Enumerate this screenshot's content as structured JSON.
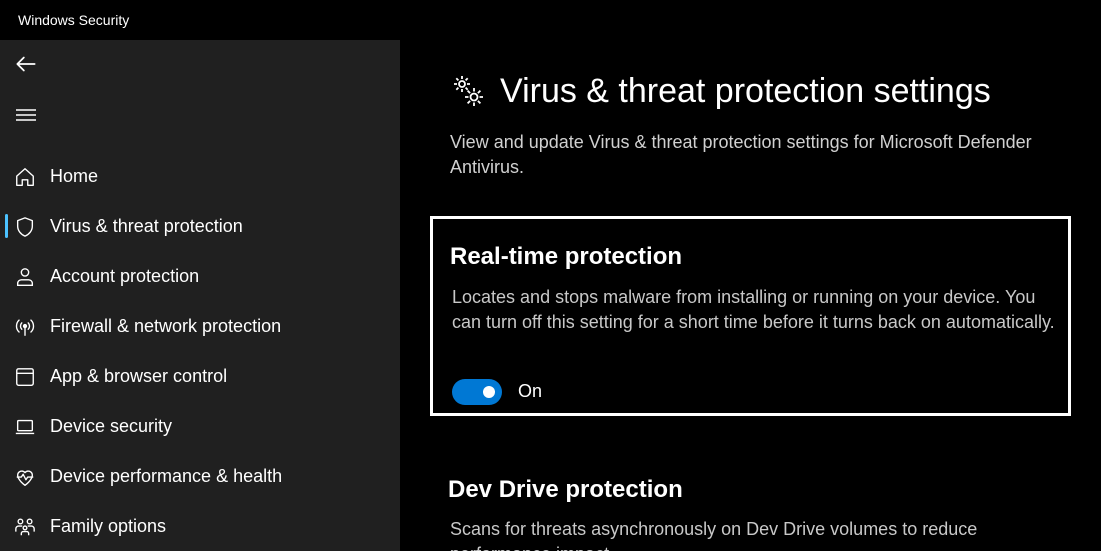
{
  "window": {
    "title": "Windows Security"
  },
  "sidebar": {
    "items": [
      {
        "label": "Home",
        "icon": "home-icon"
      },
      {
        "label": "Virus & threat protection",
        "icon": "shield-icon",
        "selected": true
      },
      {
        "label": "Account protection",
        "icon": "person-icon"
      },
      {
        "label": "Firewall & network protection",
        "icon": "wireless-icon"
      },
      {
        "label": "App & browser control",
        "icon": "app-window-icon"
      },
      {
        "label": "Device security",
        "icon": "laptop-icon"
      },
      {
        "label": "Device performance & health",
        "icon": "heart-pulse-icon"
      },
      {
        "label": "Family options",
        "icon": "family-icon"
      }
    ]
  },
  "main": {
    "title": "Virus & threat protection settings",
    "title_icon": "gears-icon",
    "description": "View and update Virus & threat protection settings for Microsoft Defender Antivirus.",
    "realtime": {
      "title": "Real-time protection",
      "description": "Locates and stops malware from installing or running on your device. You can turn off this setting for a short time before it turns back on automatically.",
      "toggle_state": "On"
    },
    "devdrive": {
      "title": "Dev Drive protection",
      "description": "Scans for threats asynchronously on Dev Drive volumes to reduce performance impact."
    }
  },
  "colors": {
    "accent": "#0078d4",
    "selection": "#4cc2ff",
    "sidebar_bg": "#202020",
    "main_bg": "#000000"
  }
}
